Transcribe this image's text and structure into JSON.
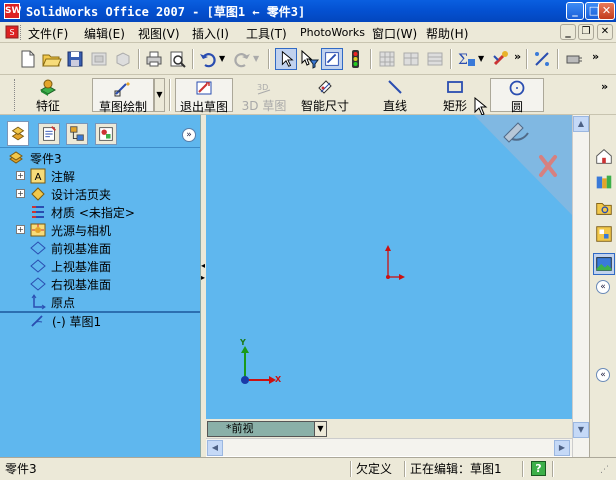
{
  "window": {
    "app_icon": "SW",
    "title": "SolidWorks Office 2007 - [草图1 ← 零件3]",
    "buttons": [
      "minimize",
      "maximize",
      "close"
    ]
  },
  "menu": {
    "items": [
      "文件(F)",
      "编辑(E)",
      "视图(V)",
      "插入(I)",
      "工具(T)",
      "PhotoWorks",
      "窗口(W)",
      "帮助(H)"
    ]
  },
  "toolbar": {
    "overflow": "»"
  },
  "command_manager": {
    "feature_label": "特征",
    "sketch_label": "草图绘制",
    "exit_sketch_label": "退出草图",
    "sketch3d_label": "3D 草图",
    "smart_dim_label": "智能尺寸",
    "line_label": "直线",
    "rect_label": "矩形",
    "circle_label": "圆"
  },
  "feature_tree": {
    "root": "零件3",
    "items": [
      "注解",
      "设计活页夹",
      "材质 <未指定>",
      "光源与相机",
      "前视基准面",
      "上视基准面",
      "右视基准面",
      "原点"
    ],
    "sketch": "(-) 草图1",
    "collapse": "»"
  },
  "graphics": {
    "view_name": "*前视",
    "triad_x": "X",
    "triad_y": "Y"
  },
  "status_bar": {
    "left": "零件3",
    "state": "欠定义",
    "editing": "正在编辑：草图1",
    "help": "?"
  },
  "colors": {
    "background": "#5fb7ee",
    "title_bar": "#0450d0",
    "origin": "#cc1111"
  }
}
